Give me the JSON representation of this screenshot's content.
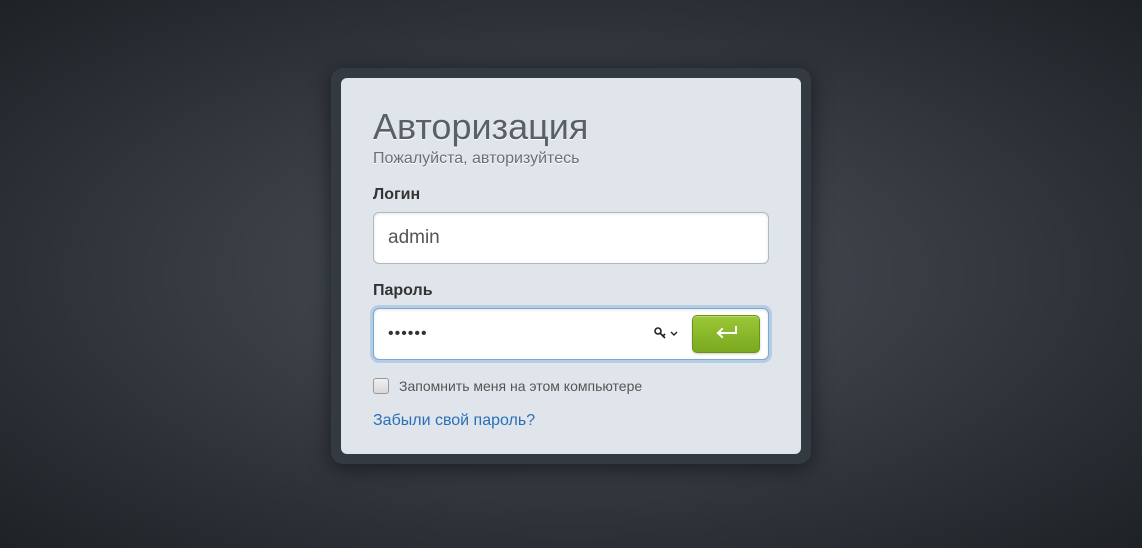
{
  "title": "Авторизация",
  "subtitle": "Пожалуйста, авторизуйтесь",
  "login": {
    "label": "Логин",
    "value": "admin"
  },
  "password": {
    "label": "Пароль",
    "value": "••••••"
  },
  "remember": {
    "label": "Запомнить меня на этом компьютере",
    "checked": false
  },
  "forgot_link": "Забыли свой пароль?"
}
